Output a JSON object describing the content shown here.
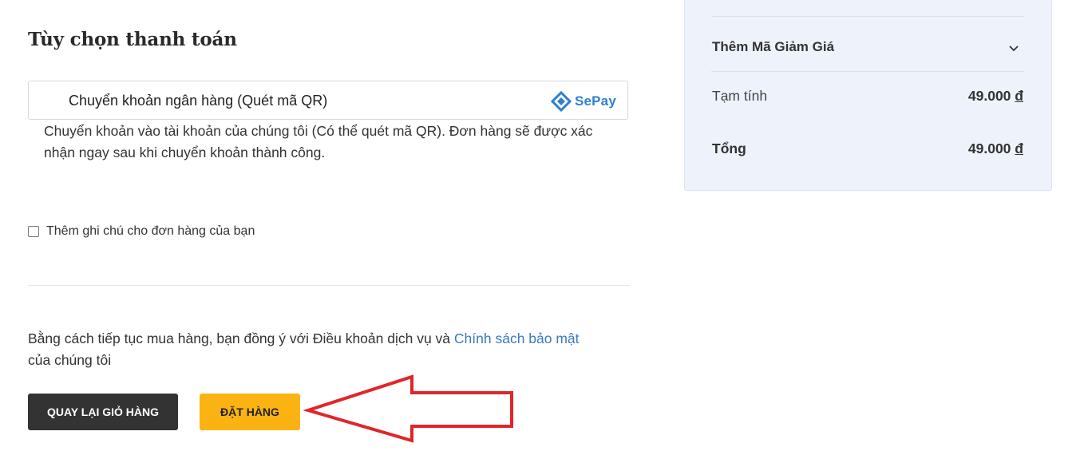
{
  "payment": {
    "section_title": "Tùy chọn thanh toán",
    "option_label": "Chuyển khoản ngân hàng (Quét mã QR)",
    "provider_logo_text": "SePay",
    "description": "Chuyển khoản vào tài khoản của chúng tôi (Có thể quét mã QR). Đơn hàng sẽ được xác nhận ngay sau khi chuyển khoản thành công."
  },
  "order_note": {
    "label": "Thêm ghi chú cho đơn hàng của bạn",
    "checked": false
  },
  "terms": {
    "prefix": "Bằng cách tiếp tục mua hàng, bạn đồng ý với Điều khoản dịch vụ và ",
    "link_text": "Chính sách bảo mật",
    "suffix": " của chúng tôi"
  },
  "actions": {
    "back_label": "QUAY LẠI GIỎ HÀNG",
    "order_label": "ĐẶT HÀNG"
  },
  "summary": {
    "coupon_label": "Thêm Mã Giảm Giá",
    "subtotal_label": "Tạm tính",
    "subtotal_value": "49.000",
    "total_label": "Tổng",
    "total_value": "49.000",
    "currency_symbol": "đ"
  },
  "colors": {
    "order_button": "#fbb313",
    "back_button": "#333333",
    "link": "#3a7bb8",
    "summary_bg": "#eef3fb",
    "annotation_arrow": "#e0262b",
    "sepay_blue": "#2f7fd1"
  },
  "icons": {
    "coupon_toggle": "chevron-down-icon",
    "provider_logo": "sepay-logo-icon",
    "annotation": "arrow-left-icon"
  }
}
